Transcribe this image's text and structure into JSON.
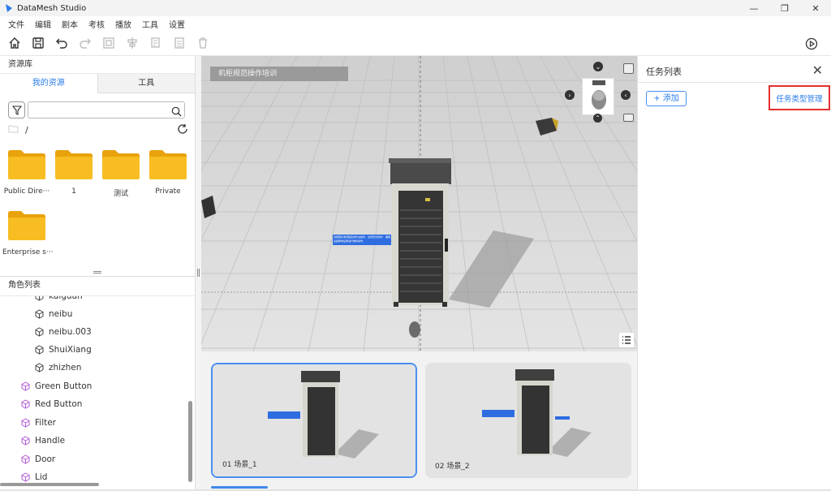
{
  "app": {
    "title": "DataMesh Studio"
  },
  "window_controls": {
    "minimize": "—",
    "maximize": "❐",
    "close": "✕"
  },
  "menu": [
    "文件",
    "编辑",
    "剧本",
    "考核",
    "播放",
    "工具",
    "设置"
  ],
  "toolbar_icons": [
    "home-icon",
    "save-icon",
    "undo-icon",
    "redo-icon",
    "group-icon",
    "align-icon",
    "copy-icon",
    "paste-icon",
    "delete-icon",
    "play-circle-icon"
  ],
  "left": {
    "title": "资源库",
    "tabs": [
      "我的资源",
      "工具"
    ],
    "search": {
      "value": "",
      "placeholder": ""
    },
    "path": "/",
    "folders": [
      "Public Dire···",
      "1",
      "测试",
      "Private",
      "Enterprise s···"
    ]
  },
  "roles": {
    "title": "角色列表",
    "children": [
      "kaiguan",
      "neibu",
      "neibu.003",
      "ShuiXiang",
      "zhizhen"
    ],
    "items": [
      "Green Button",
      "Red Button",
      "Filter",
      "Handle",
      "Door",
      "Lid"
    ]
  },
  "viewport": {
    "scene_name": "机柜规范操作培训",
    "sign_text": "请按照标准流程完成作业操作，注意安全防护！ 确保设备断电后再进行维护操作。"
  },
  "scenes": [
    {
      "label": "01  场景_1",
      "selected": true
    },
    {
      "label": "02  场景_2",
      "selected": false
    }
  ],
  "right": {
    "title": "任务列表",
    "close": "✕",
    "add_button": "+ 添加",
    "manage_button": "任务类型管理"
  },
  "colors": {
    "accent": "#2b7de9",
    "highlight_border": "#e53030",
    "folder": "#f6b820"
  }
}
